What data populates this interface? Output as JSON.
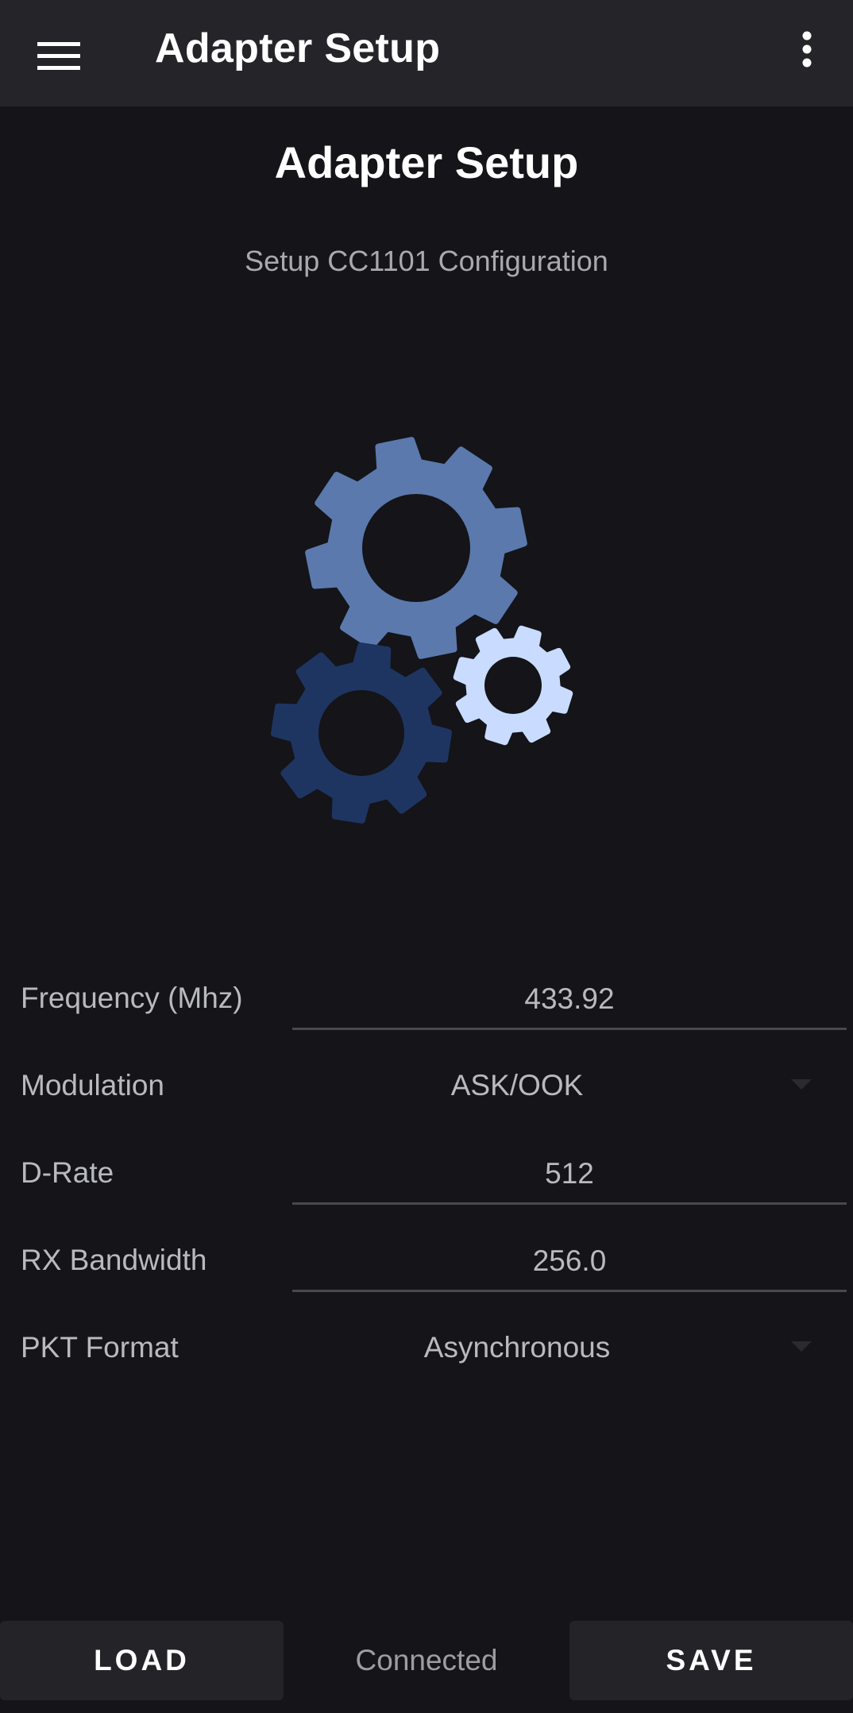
{
  "appbar": {
    "title": "Adapter Setup",
    "menu_icon": "hamburger-menu-icon",
    "overflow_icon": "more-vert-icon"
  },
  "page": {
    "title": "Adapter Setup",
    "subtitle": "Setup CC1101 Configuration"
  },
  "illustration": {
    "icon": "gears-icon",
    "colors": {
      "large_gear": "#5b79ad",
      "small_gear": "#c9dcff",
      "dark_gear": "#1f3561"
    }
  },
  "form": {
    "frequency": {
      "label": "Frequency (Mhz)",
      "value": "433.92"
    },
    "modulation": {
      "label": "Modulation",
      "value": "ASK/OOK"
    },
    "d_rate": {
      "label": "D-Rate",
      "value": "512"
    },
    "rx_bandwidth": {
      "label": "RX Bandwidth",
      "value": "256.0"
    },
    "pkt_format": {
      "label": "PKT Format",
      "value": "Asynchronous"
    }
  },
  "footer": {
    "load_label": "LOAD",
    "status": "Connected",
    "save_label": "SAVE"
  },
  "colors": {
    "background": "#141419",
    "appbar": "#242429",
    "button": "#232328",
    "underline": "#48484f"
  }
}
